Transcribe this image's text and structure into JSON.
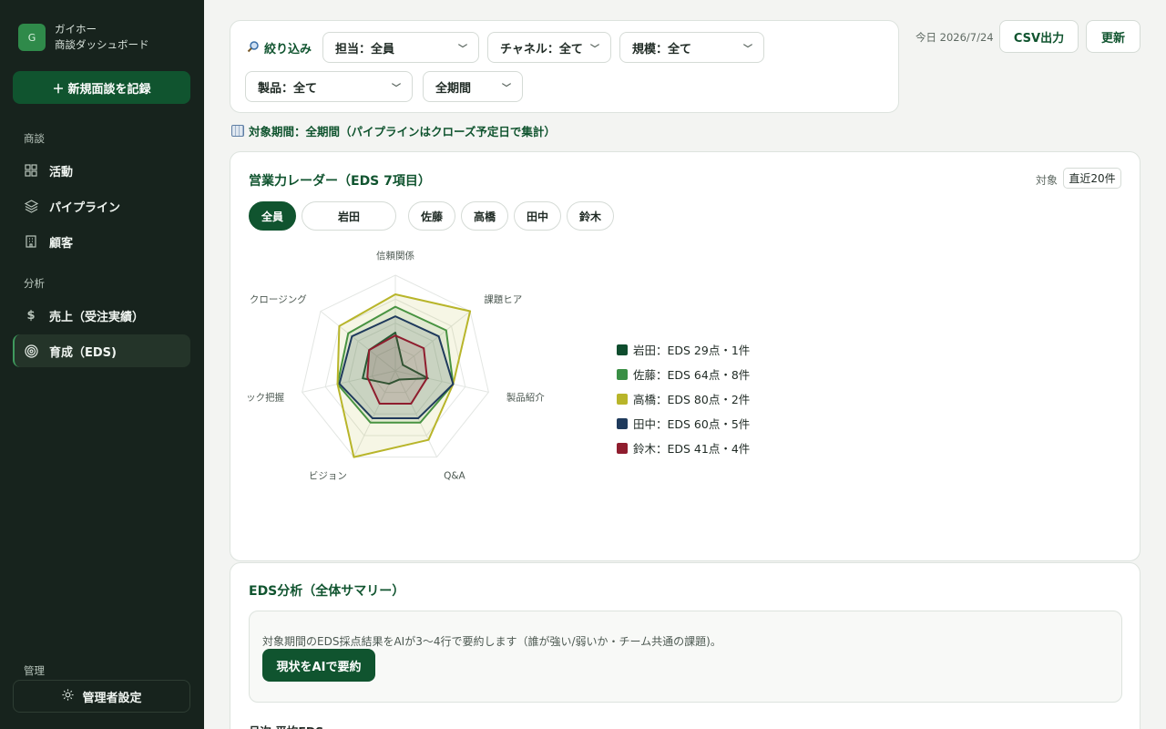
{
  "sidebar": {
    "logo": "G",
    "company": "ガイホー",
    "app_name": "商談ダッシュボード",
    "new_button": "新規面談を記録",
    "sections": {
      "deals": "商談",
      "analysis": "分析",
      "admin": "管理"
    },
    "items": [
      {
        "label": "活動",
        "icon": "grid-icon"
      },
      {
        "label": "パイプライン",
        "icon": "layers-icon"
      },
      {
        "label": "顧客",
        "icon": "building-icon"
      },
      {
        "label": "売上（受注実績）",
        "icon": "dollar-icon"
      },
      {
        "label": "育成（EDS)",
        "icon": "target-icon",
        "active": true
      }
    ],
    "admin_button": "管理者設定"
  },
  "filters": {
    "title": "絞り込み",
    "owner": "担当：全員",
    "channel": "チャネル：全て",
    "scale": "規模：全て",
    "product": "製品：全て",
    "period": "全期間"
  },
  "header": {
    "today": "今日 2026/7/24",
    "csv_button": "CSV出力",
    "refresh_button": "更新"
  },
  "period_note": "対象期間：全期間（パイプラインはクローズ予定日で集計）",
  "radar_card": {
    "title": "営業力レーダー（EDS 7項目）",
    "target_label": "対象",
    "target_value": "直近20件",
    "person_tabs": [
      "全員",
      "岩田",
      "佐藤",
      "高橋",
      "田中",
      "鈴木"
    ],
    "active_tab": "全員"
  },
  "chart_data": {
    "type": "radar",
    "axes": [
      "信頼関係",
      "課題ヒア",
      "製品紹介",
      "Q&A",
      "ビジョン",
      "ック把握",
      "クロージング"
    ],
    "series": [
      {
        "name": "岩田",
        "legend": "岩田：EDS 29点・1件",
        "color": "#0f4d2e",
        "values": [
          40,
          10,
          35,
          10,
          15,
          35,
          35
        ]
      },
      {
        "name": "佐藤",
        "legend": "佐藤：EDS 64点・8件",
        "color": "#3a8f45",
        "values": [
          67,
          68,
          62,
          60,
          60,
          62,
          63
        ]
      },
      {
        "name": "高橋",
        "legend": "高橋：EDS 80点・2件",
        "color": "#b8b52a",
        "values": [
          80,
          100,
          62,
          80,
          100,
          62,
          75
        ]
      },
      {
        "name": "田中",
        "legend": "田中：EDS 60点・5件",
        "color": "#1f3a5c",
        "values": [
          57,
          58,
          62,
          55,
          55,
          60,
          58
        ]
      },
      {
        "name": "鈴木",
        "legend": "鈴木：EDS 41点・4件",
        "color": "#8f1d2e",
        "values": [
          37,
          38,
          34,
          38,
          38,
          30,
          35
        ]
      }
    ],
    "rlim": [
      0,
      100
    ]
  },
  "eds_card": {
    "title": "EDS分析（全体サマリー）",
    "summary_text": "対象期間のEDS採点結果をAIが3〜4行で要約します（誰が強い/弱いか・チーム共通の課題)。",
    "ai_button": "現状をAIで要約",
    "monthly_label": "月次 平均EDS"
  }
}
